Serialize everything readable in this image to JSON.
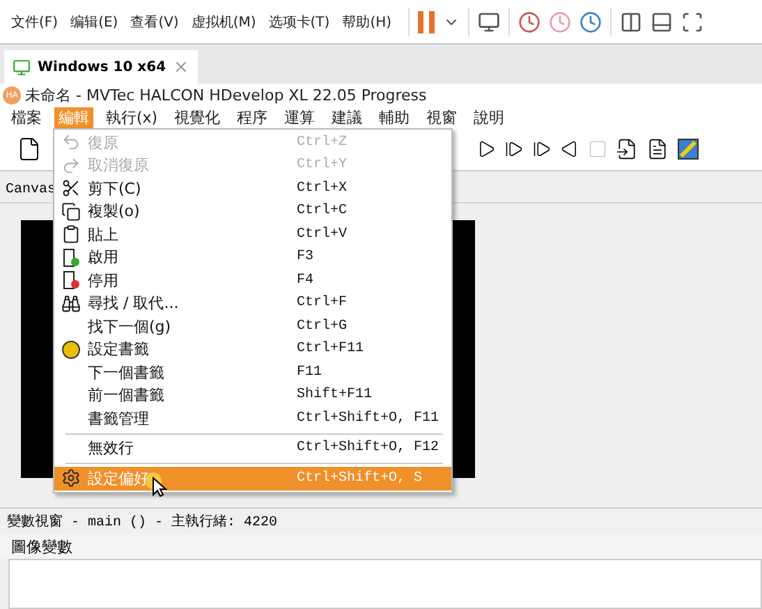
{
  "vm_menu": [
    "文件(F)",
    "编辑(E)",
    "查看(V)",
    "虚拟机(M)",
    "选项卡(T)",
    "帮助(H)"
  ],
  "vm_tab": {
    "title": "Windows 10 x64",
    "selected": true
  },
  "app_logo": "HA",
  "app_title": "未命名 - MVTec HALCON HDevelop XL 22.05 Progress",
  "menu": [
    {
      "label": "檔案",
      "selected": false
    },
    {
      "label": "編輯",
      "selected": true
    },
    {
      "label": "執行(x)",
      "selected": false
    },
    {
      "label": "視覺化",
      "selected": false
    },
    {
      "label": "程序",
      "selected": false
    },
    {
      "label": "運算",
      "selected": false
    },
    {
      "label": "建議",
      "selected": false
    },
    {
      "label": "輔助",
      "selected": false
    },
    {
      "label": "視窗",
      "selected": false
    },
    {
      "label": "說明",
      "selected": false
    }
  ],
  "canvas_tab": "Canvas",
  "dropdown": [
    {
      "kind": "item",
      "label": "復原",
      "shortcut": "Ctrl+Z",
      "disabled": true,
      "selected": false
    },
    {
      "kind": "item",
      "label": "取消復原",
      "shortcut": "Ctrl+Y",
      "disabled": true,
      "selected": false
    },
    {
      "kind": "item",
      "label": "剪下(C)",
      "shortcut": "Ctrl+X",
      "disabled": false,
      "selected": false
    },
    {
      "kind": "item",
      "label": "複製(o)",
      "shortcut": "Ctrl+C",
      "disabled": false,
      "selected": false
    },
    {
      "kind": "item",
      "label": "貼上",
      "shortcut": "Ctrl+V",
      "disabled": false,
      "selected": false
    },
    {
      "kind": "item",
      "label": "啟用",
      "shortcut": "F3",
      "disabled": false,
      "selected": false
    },
    {
      "kind": "item",
      "label": "停用",
      "shortcut": "F4",
      "disabled": false,
      "selected": false
    },
    {
      "kind": "item",
      "label": "尋找 / 取代...",
      "shortcut": "Ctrl+F",
      "disabled": false,
      "selected": false
    },
    {
      "kind": "item",
      "label": "找下一個(g)",
      "shortcut": "Ctrl+G",
      "disabled": false,
      "selected": false
    },
    {
      "kind": "item",
      "label": "設定書籤",
      "shortcut": "Ctrl+F11",
      "disabled": false,
      "selected": false
    },
    {
      "kind": "item",
      "label": "下一個書籤",
      "shortcut": "F11",
      "disabled": false,
      "selected": false
    },
    {
      "kind": "item",
      "label": "前一個書籤",
      "shortcut": "Shift+F11",
      "disabled": false,
      "selected": false
    },
    {
      "kind": "item",
      "label": "書籤管理",
      "shortcut": "Ctrl+Shift+O, F11",
      "disabled": false,
      "selected": false
    },
    {
      "kind": "separator"
    },
    {
      "kind": "item",
      "label": "無效行",
      "shortcut": "Ctrl+Shift+O, F12",
      "disabled": false,
      "selected": false
    },
    {
      "kind": "separator"
    },
    {
      "kind": "item",
      "label": "設定偏好",
      "shortcut": "Ctrl+Shift+O, S",
      "disabled": false,
      "selected": true
    }
  ],
  "status": "變數視窗 - main () - 主執行緒: 4220",
  "variables_title": "圖像變數"
}
